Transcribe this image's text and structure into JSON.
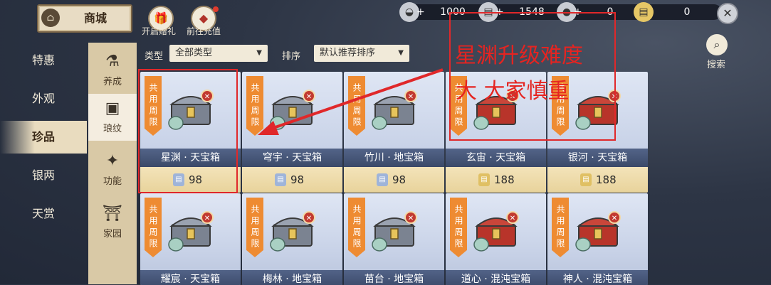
{
  "header": {
    "title": "商城",
    "gift_label": "开启赠礼",
    "recharge_label": "前往充值",
    "close_icon": "close-icon",
    "search_label": "搜索"
  },
  "currencies": [
    {
      "icon": "silver-ingot-icon",
      "value": "1000"
    },
    {
      "icon": "silver-note-icon",
      "value": "1548"
    },
    {
      "icon": "coin-bag-icon",
      "value": "0"
    },
    {
      "icon": "gold-note-icon",
      "value": "0"
    }
  ],
  "left_nav": [
    "特惠",
    "外观",
    "珍品",
    "银两",
    "天赏"
  ],
  "left_nav_active": "珍品",
  "sub_nav": [
    {
      "label": "养成",
      "icon": "cultivate-icon"
    },
    {
      "label": "琅纹",
      "icon": "pattern-icon"
    },
    {
      "label": "功能",
      "icon": "star-function-icon"
    },
    {
      "label": "家园",
      "icon": "home-icon"
    }
  ],
  "filters": {
    "type_label": "类型",
    "type_value": "全部类型",
    "sort_label": "排序",
    "sort_value": "默认推荐排序"
  },
  "tag_text": "共用周限",
  "items": [
    {
      "name": "星渊 · 天宝箱",
      "price": "98",
      "currency": "silver"
    },
    {
      "name": "穹宇 · 天宝箱",
      "price": "98",
      "currency": "silver"
    },
    {
      "name": "竹川 · 地宝箱",
      "price": "98",
      "currency": "silver"
    },
    {
      "name": "玄宙 · 天宝箱",
      "price": "188",
      "currency": "gold"
    },
    {
      "name": "银河 · 天宝箱",
      "price": "188",
      "currency": "gold"
    },
    {
      "name": "耀宸 · 天宝箱",
      "price": "",
      "currency": "silver"
    },
    {
      "name": "梅林 · 地宝箱",
      "price": "",
      "currency": "silver"
    },
    {
      "name": "苗台 · 地宝箱",
      "price": "",
      "currency": "silver"
    },
    {
      "name": "道心 · 混沌宝箱",
      "price": "",
      "currency": "gold"
    },
    {
      "name": "神人 · 混沌宝箱",
      "price": "",
      "currency": "gold"
    }
  ],
  "annotation": {
    "line1": "星渊升级难度",
    "line2": "大 大家慎重",
    "color": "#e0282a"
  }
}
